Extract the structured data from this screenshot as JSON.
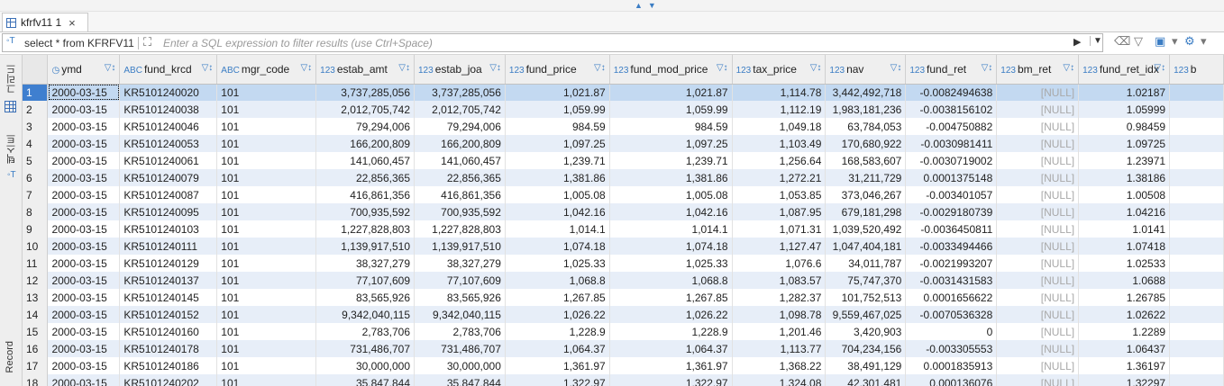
{
  "tab": {
    "title": "kfrfv11 1",
    "close": "×"
  },
  "filter": {
    "query": "select * from KFRFV11",
    "placeholder": "Enter a SQL expression to filter results (use Ctrl+Space)"
  },
  "side_panel": {
    "grid_label": "그리드",
    "text_label": "텍스트",
    "record_label": "Record"
  },
  "columns": [
    {
      "type": "◷",
      "label": "ymd"
    },
    {
      "type": "ABC",
      "label": "fund_krcd"
    },
    {
      "type": "ABC",
      "label": "mgr_code"
    },
    {
      "type": "123",
      "label": "estab_amt"
    },
    {
      "type": "123",
      "label": "estab_joa"
    },
    {
      "type": "123",
      "label": "fund_price"
    },
    {
      "type": "123",
      "label": "fund_mod_price"
    },
    {
      "type": "123",
      "label": "tax_price"
    },
    {
      "type": "123",
      "label": "nav"
    },
    {
      "type": "123",
      "label": "fund_ret"
    },
    {
      "type": "123",
      "label": "bm_ret"
    },
    {
      "type": "123",
      "label": "fund_ret_idx"
    },
    {
      "type": "123",
      "label": "b"
    }
  ],
  "rows": [
    [
      "1",
      "2000-03-15",
      "KR5101240020",
      "101",
      "3,737,285,056",
      "3,737,285,056",
      "1,021.87",
      "1,021.87",
      "1,114.78",
      "3,442,492,718",
      "-0.0082494638",
      "[NULL]",
      "1.02187",
      ""
    ],
    [
      "2",
      "2000-03-15",
      "KR5101240038",
      "101",
      "2,012,705,742",
      "2,012,705,742",
      "1,059.99",
      "1,059.99",
      "1,112.19",
      "1,983,181,236",
      "-0.0038156102",
      "[NULL]",
      "1.05999",
      ""
    ],
    [
      "3",
      "2000-03-15",
      "KR5101240046",
      "101",
      "79,294,006",
      "79,294,006",
      "984.59",
      "984.59",
      "1,049.18",
      "63,784,053",
      "-0.004750882",
      "[NULL]",
      "0.98459",
      ""
    ],
    [
      "4",
      "2000-03-15",
      "KR5101240053",
      "101",
      "166,200,809",
      "166,200,809",
      "1,097.25",
      "1,097.25",
      "1,103.49",
      "170,680,922",
      "-0.0030981411",
      "[NULL]",
      "1.09725",
      ""
    ],
    [
      "5",
      "2000-03-15",
      "KR5101240061",
      "101",
      "141,060,457",
      "141,060,457",
      "1,239.71",
      "1,239.71",
      "1,256.64",
      "168,583,607",
      "-0.0030719002",
      "[NULL]",
      "1.23971",
      ""
    ],
    [
      "6",
      "2000-03-15",
      "KR5101240079",
      "101",
      "22,856,365",
      "22,856,365",
      "1,381.86",
      "1,381.86",
      "1,272.21",
      "31,211,729",
      "0.0001375148",
      "[NULL]",
      "1.38186",
      ""
    ],
    [
      "7",
      "2000-03-15",
      "KR5101240087",
      "101",
      "416,861,356",
      "416,861,356",
      "1,005.08",
      "1,005.08",
      "1,053.85",
      "373,046,267",
      "-0.003401057",
      "[NULL]",
      "1.00508",
      ""
    ],
    [
      "8",
      "2000-03-15",
      "KR5101240095",
      "101",
      "700,935,592",
      "700,935,592",
      "1,042.16",
      "1,042.16",
      "1,087.95",
      "679,181,298",
      "-0.0029180739",
      "[NULL]",
      "1.04216",
      ""
    ],
    [
      "9",
      "2000-03-15",
      "KR5101240103",
      "101",
      "1,227,828,803",
      "1,227,828,803",
      "1,014.1",
      "1,014.1",
      "1,071.31",
      "1,039,520,492",
      "-0.0036450811",
      "[NULL]",
      "1.0141",
      ""
    ],
    [
      "10",
      "2000-03-15",
      "KR5101240111",
      "101",
      "1,139,917,510",
      "1,139,917,510",
      "1,074.18",
      "1,074.18",
      "1,127.47",
      "1,047,404,181",
      "-0.0033494466",
      "[NULL]",
      "1.07418",
      ""
    ],
    [
      "11",
      "2000-03-15",
      "KR5101240129",
      "101",
      "38,327,279",
      "38,327,279",
      "1,025.33",
      "1,025.33",
      "1,076.6",
      "34,011,787",
      "-0.0021993207",
      "[NULL]",
      "1.02533",
      ""
    ],
    [
      "12",
      "2000-03-15",
      "KR5101240137",
      "101",
      "77,107,609",
      "77,107,609",
      "1,068.8",
      "1,068.8",
      "1,083.57",
      "75,747,370",
      "-0.0031431583",
      "[NULL]",
      "1.0688",
      ""
    ],
    [
      "13",
      "2000-03-15",
      "KR5101240145",
      "101",
      "83,565,926",
      "83,565,926",
      "1,267.85",
      "1,267.85",
      "1,282.37",
      "101,752,513",
      "0.0001656622",
      "[NULL]",
      "1.26785",
      ""
    ],
    [
      "14",
      "2000-03-15",
      "KR5101240152",
      "101",
      "9,342,040,115",
      "9,342,040,115",
      "1,026.22",
      "1,026.22",
      "1,098.78",
      "9,559,467,025",
      "-0.0070536328",
      "[NULL]",
      "1.02622",
      ""
    ],
    [
      "15",
      "2000-03-15",
      "KR5101240160",
      "101",
      "2,783,706",
      "2,783,706",
      "1,228.9",
      "1,228.9",
      "1,201.46",
      "3,420,903",
      "0",
      "[NULL]",
      "1.2289",
      ""
    ],
    [
      "16",
      "2000-03-15",
      "KR5101240178",
      "101",
      "731,486,707",
      "731,486,707",
      "1,064.37",
      "1,064.37",
      "1,113.77",
      "704,234,156",
      "-0.003305553",
      "[NULL]",
      "1.06437",
      ""
    ],
    [
      "17",
      "2000-03-15",
      "KR5101240186",
      "101",
      "30,000,000",
      "30,000,000",
      "1,361.97",
      "1,361.97",
      "1,368.22",
      "38,491,129",
      "0.0001835913",
      "[NULL]",
      "1.36197",
      ""
    ],
    [
      "18",
      "2000-03-15",
      "KR5101240202",
      "101",
      "35,847,844",
      "35,847,844",
      "1,322.97",
      "1,322.97",
      "1,324.08",
      "42,301,481",
      "0.000136076",
      "[NULL]",
      "1.32297",
      ""
    ]
  ],
  "selected_row": 0,
  "colors": {
    "header_bg": "#efefef",
    "even_row": "#e7eef8",
    "selected_row": "#c3d9f1",
    "accent": "#3b7dc4"
  }
}
